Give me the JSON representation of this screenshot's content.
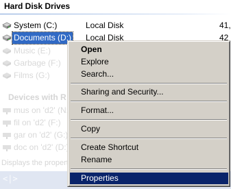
{
  "explorer": {
    "group_header": "Hard Disk Drives",
    "drives": [
      {
        "name": "System (C:)",
        "type": "Local Disk",
        "size": "41,"
      },
      {
        "name": "Documents (D:)",
        "type": "Local Disk",
        "size": "42"
      }
    ],
    "hidden_drives": [
      {
        "name": "Music (E:)"
      },
      {
        "name": "Garbage (F:)"
      },
      {
        "name": "Films (G:)"
      }
    ],
    "removable_header": "Devices with R",
    "network_drives": [
      {
        "name": "mus on 'd2' (N:)"
      },
      {
        "name": "fil on 'd2' (F:)"
      },
      {
        "name": "gar on 'd2' (G:)"
      },
      {
        "name": "doc on 'd2' (D:)"
      }
    ],
    "status_text": "Displays the propert",
    "nav_glyph": "<|>"
  },
  "context_menu": {
    "items": [
      {
        "label": "Open",
        "bold": true
      },
      {
        "label": "Explore"
      },
      {
        "label": "Search..."
      },
      {
        "label": "Sharing and Security..."
      },
      {
        "label": "Format..."
      },
      {
        "label": "Copy"
      },
      {
        "label": "Create Shortcut"
      },
      {
        "label": "Rename"
      },
      {
        "label": "Properties",
        "highlighted": true
      }
    ]
  },
  "colors": {
    "selection": "#316ac5",
    "menu_face": "#d4d0c8",
    "menu_highlight": "#0a246a"
  },
  "icons": [
    "hard-drive-icon",
    "network-drive-icon"
  ]
}
